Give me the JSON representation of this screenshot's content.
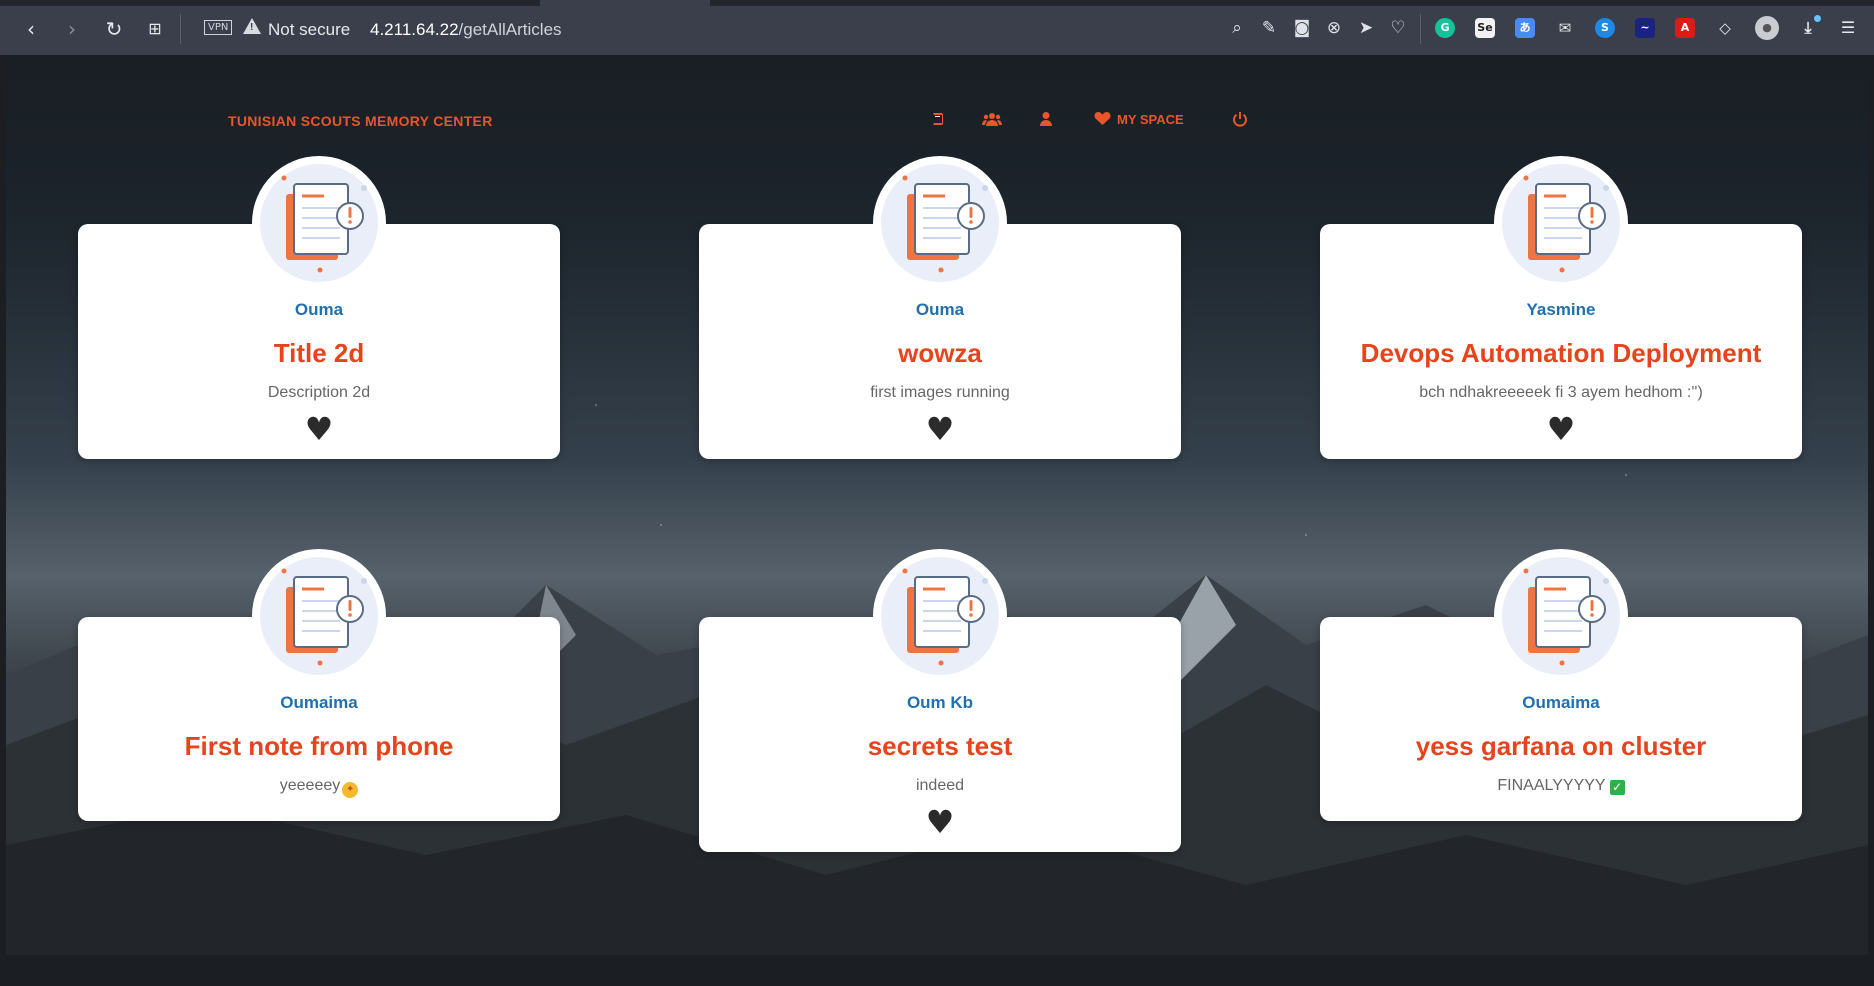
{
  "browser": {
    "vpn_label": "VPN",
    "security_text": "Not secure",
    "url_host": "4.211.64.22",
    "url_path": "/getAllArticles"
  },
  "header": {
    "brand": "TUNISIAN SCOUTS MEMORY CENTER",
    "nav": [
      {
        "icon": "book-icon",
        "label": ""
      },
      {
        "icon": "users-icon",
        "label": ""
      },
      {
        "icon": "user-icon",
        "label": ""
      },
      {
        "icon": "heart-icon",
        "label": "MY SPACE"
      },
      {
        "icon": "power-icon",
        "label": ""
      }
    ]
  },
  "articles": [
    {
      "author": "Ouma",
      "title": "Title 2d",
      "description": "Description 2d",
      "liked": true
    },
    {
      "author": "Ouma",
      "title": "wowza",
      "description": "first images running",
      "liked": true
    },
    {
      "author": "Yasmine",
      "title": "Devops Automation Deployment",
      "description": "bch ndhakreeeeek fi 3 ayem hedhom :'')",
      "liked": true
    },
    {
      "author": "Oumaima",
      "title": "First note from phone",
      "description": "yeeeeey",
      "liked": false
    },
    {
      "author": "Oum Kb",
      "title": "secrets test",
      "description": "indeed",
      "liked": true
    },
    {
      "author": "Oumaima",
      "title": "yess garfana on cluster",
      "description": "FINAALYYYYY",
      "liked": false
    }
  ],
  "colors": {
    "accent": "#e8562a",
    "title": "#e8441c",
    "author": "#1f6fb2"
  }
}
